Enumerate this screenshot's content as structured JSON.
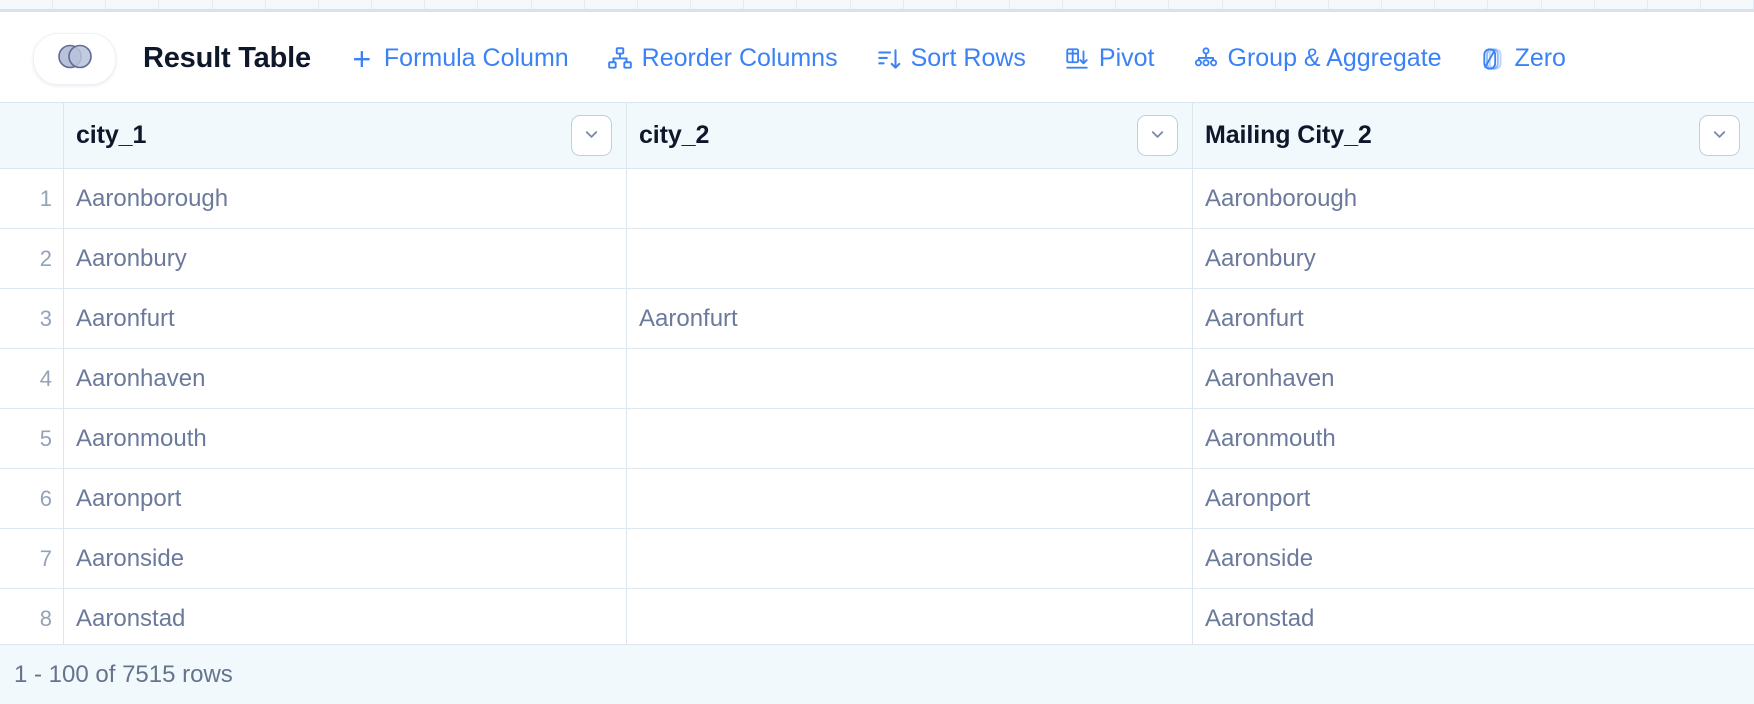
{
  "app": {
    "title": "Result Table",
    "logo_icon": "venn-diagram-icon",
    "accent_color": "#3b82f6",
    "header_text_color": "#0f172a",
    "cell_text_color": "#6b7a9c",
    "header_bg_color": "#f2f9fd"
  },
  "toolbar": {
    "items": [
      {
        "label": "Formula Column",
        "icon": "plus-icon",
        "prefix": "+"
      },
      {
        "label": "Reorder Columns",
        "icon": "reorder-columns-icon",
        "prefix": ""
      },
      {
        "label": "Sort Rows",
        "icon": "sort-descending-icon",
        "prefix": ""
      },
      {
        "label": "Pivot",
        "icon": "pivot-table-icon",
        "prefix": ""
      },
      {
        "label": "Group & Aggregate",
        "icon": "group-aggregate-icon",
        "prefix": ""
      },
      {
        "label": "Zero",
        "icon": "zero-null-icon",
        "prefix": ""
      }
    ]
  },
  "table": {
    "columns": [
      {
        "name": "city_1",
        "menu_icon": "chevron-down-icon"
      },
      {
        "name": "city_2",
        "menu_icon": "chevron-down-icon"
      },
      {
        "name": "Mailing City_2",
        "menu_icon": "chevron-down-icon"
      }
    ],
    "rows": [
      {
        "num": "1",
        "c1": "Aaronborough",
        "c2": "",
        "c3": "Aaronborough"
      },
      {
        "num": "2",
        "c1": "Aaronbury",
        "c2": "",
        "c3": "Aaronbury"
      },
      {
        "num": "3",
        "c1": "Aaronfurt",
        "c2": "Aaronfurt",
        "c3": "Aaronfurt"
      },
      {
        "num": "4",
        "c1": "Aaronhaven",
        "c2": "",
        "c3": "Aaronhaven"
      },
      {
        "num": "5",
        "c1": "Aaronmouth",
        "c2": "",
        "c3": "Aaronmouth"
      },
      {
        "num": "6",
        "c1": "Aaronport",
        "c2": "",
        "c3": "Aaronport"
      },
      {
        "num": "7",
        "c1": "Aaronside",
        "c2": "",
        "c3": "Aaronside"
      },
      {
        "num": "8",
        "c1": "Aaronstad",
        "c2": "",
        "c3": "Aaronstad"
      }
    ]
  },
  "footer": {
    "status": "1 - 100 of 7515 rows"
  }
}
